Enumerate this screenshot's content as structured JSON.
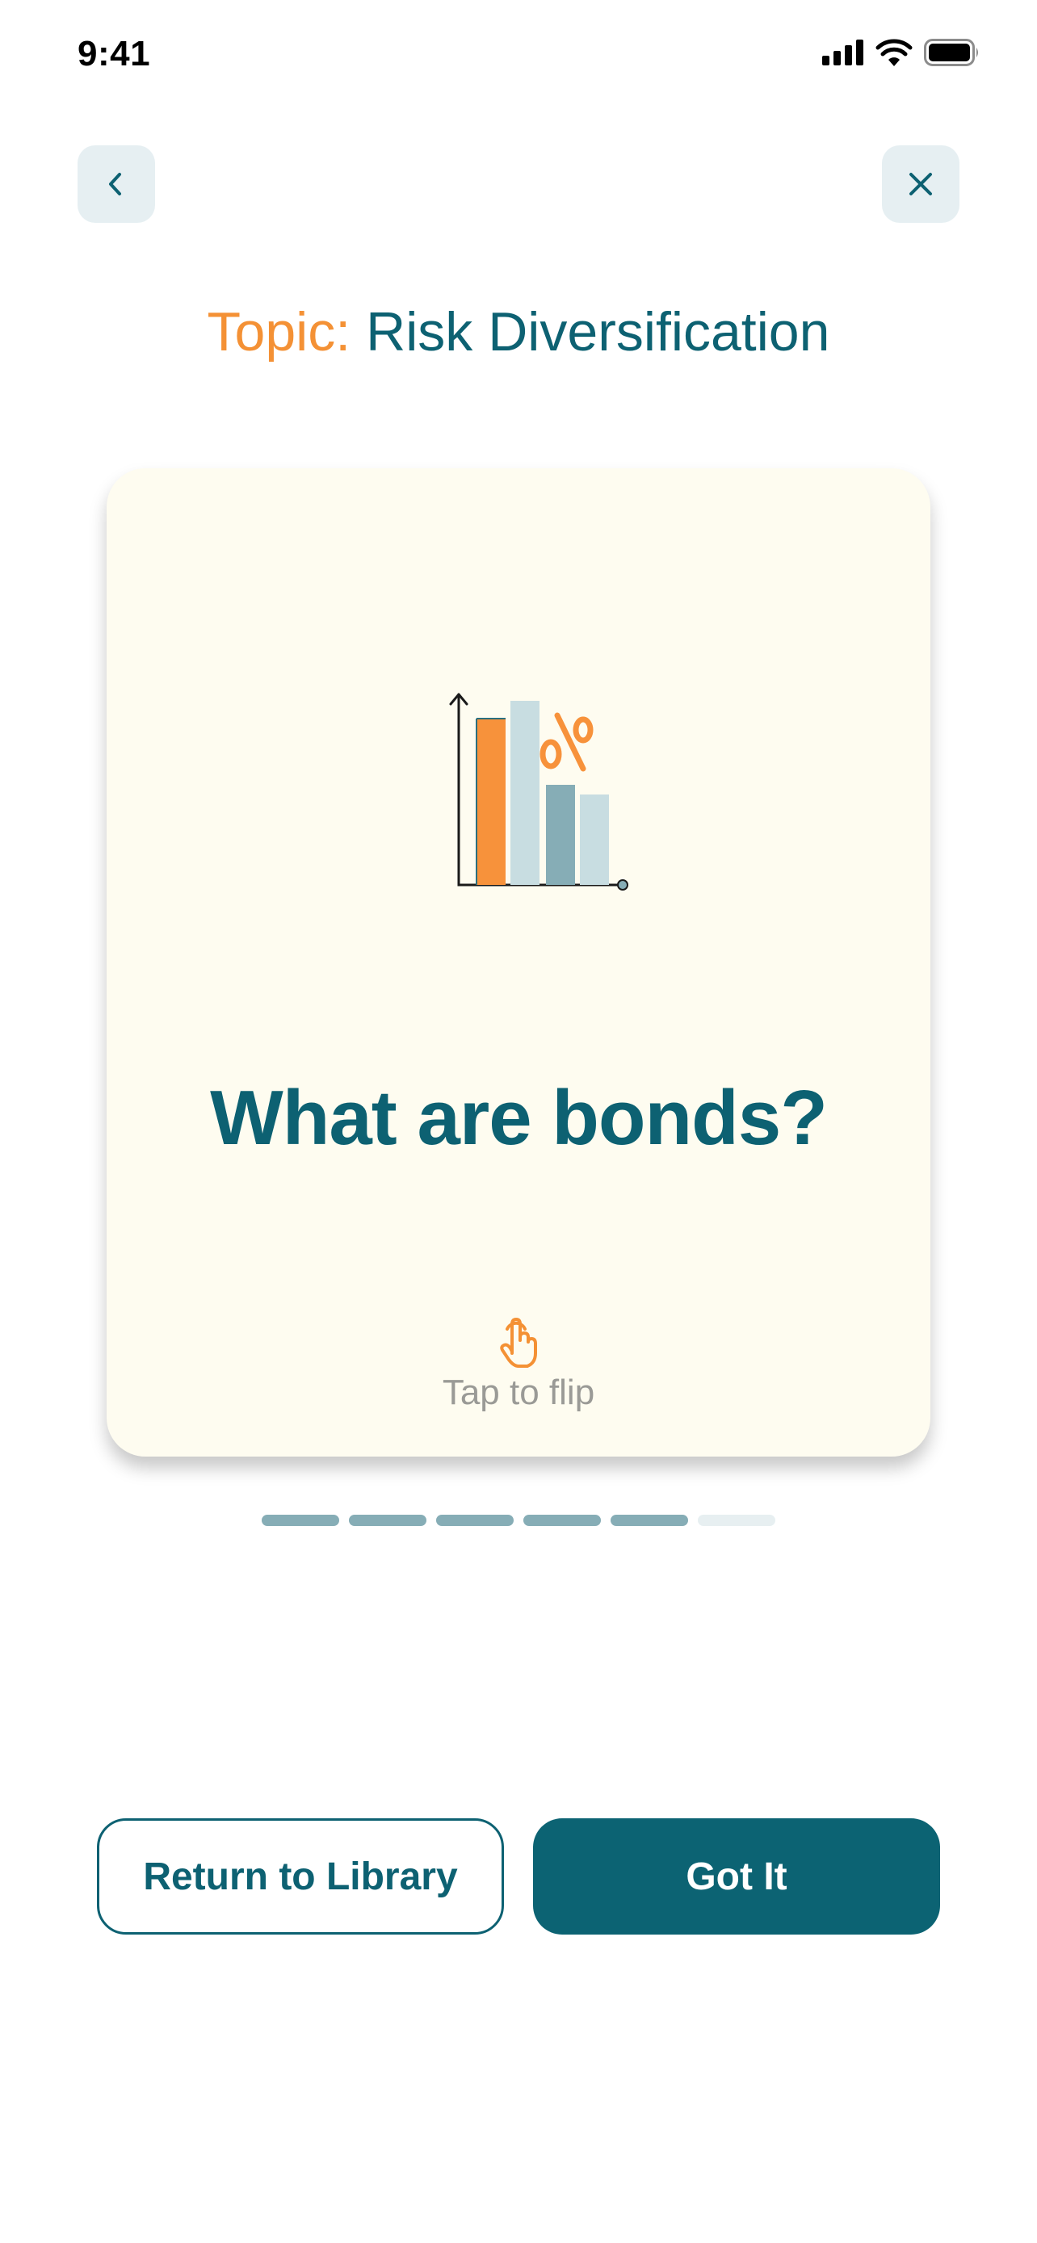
{
  "status_bar": {
    "time": "9:41",
    "icons": [
      "signal-icon",
      "wifi-icon",
      "battery-icon"
    ]
  },
  "nav": {
    "back_icon": "chevron-left-icon",
    "close_icon": "close-icon"
  },
  "topic": {
    "prefix": "Topic:",
    "name": "Risk Diversification"
  },
  "card": {
    "illustration": "bar-chart-percent-icon",
    "question": "What are bonds?",
    "tap_icon": "tap-hand-icon",
    "tap_label": "Tap to flip"
  },
  "progress": {
    "total": 6,
    "completed": 5
  },
  "actions": {
    "secondary_label": "Return to Library",
    "primary_label": "Got It"
  },
  "colors": {
    "accent_orange": "#f49135",
    "brand_teal": "#0d6172",
    "card_bg": "#fefcf0",
    "nav_btn_bg": "#e6eff2",
    "progress_active": "#86adb6",
    "progress_inactive": "#e7eff1"
  }
}
